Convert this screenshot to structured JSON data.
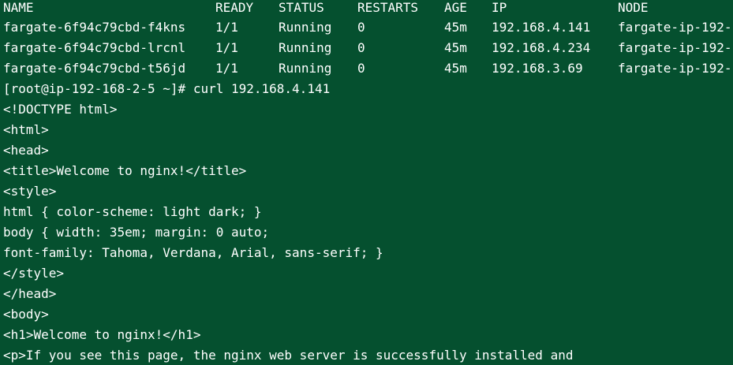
{
  "terminal": {
    "background": "#05502f",
    "foreground": "#ffffff",
    "header": {
      "name": "NAME",
      "ready": "READY",
      "status": "STATUS",
      "restarts": "RESTARTS",
      "age": "AGE",
      "ip": "IP",
      "node": "NODE"
    },
    "pods": [
      {
        "name": "fargate-6f94c79cbd-f4kns",
        "ready": "1/1",
        "status": "Running",
        "restarts": "0",
        "age": "45m",
        "ip": "192.168.4.141",
        "node": "fargate-ip-192-"
      },
      {
        "name": "fargate-6f94c79cbd-lrcnl",
        "ready": "1/1",
        "status": "Running",
        "restarts": "0",
        "age": "45m",
        "ip": "192.168.4.234",
        "node": "fargate-ip-192-"
      },
      {
        "name": "fargate-6f94c79cbd-t56jd",
        "ready": "1/1",
        "status": "Running",
        "restarts": "0",
        "age": "45m",
        "ip": "192.168.3.69",
        "node": "fargate-ip-192-"
      }
    ],
    "command_line": "[root@ip-192-168-2-5 ~]# curl 192.168.4.141",
    "output_lines": [
      "<!DOCTYPE html>",
      "<html>",
      "<head>",
      "<title>Welcome to nginx!</title>",
      "<style>",
      "html { color-scheme: light dark; }",
      "body { width: 35em; margin: 0 auto;",
      "font-family: Tahoma, Verdana, Arial, sans-serif; }",
      "</style>",
      "</head>",
      "<body>",
      "<h1>Welcome to nginx!</h1>",
      "<p>If you see this page, the nginx web server is successfully installed and"
    ]
  }
}
